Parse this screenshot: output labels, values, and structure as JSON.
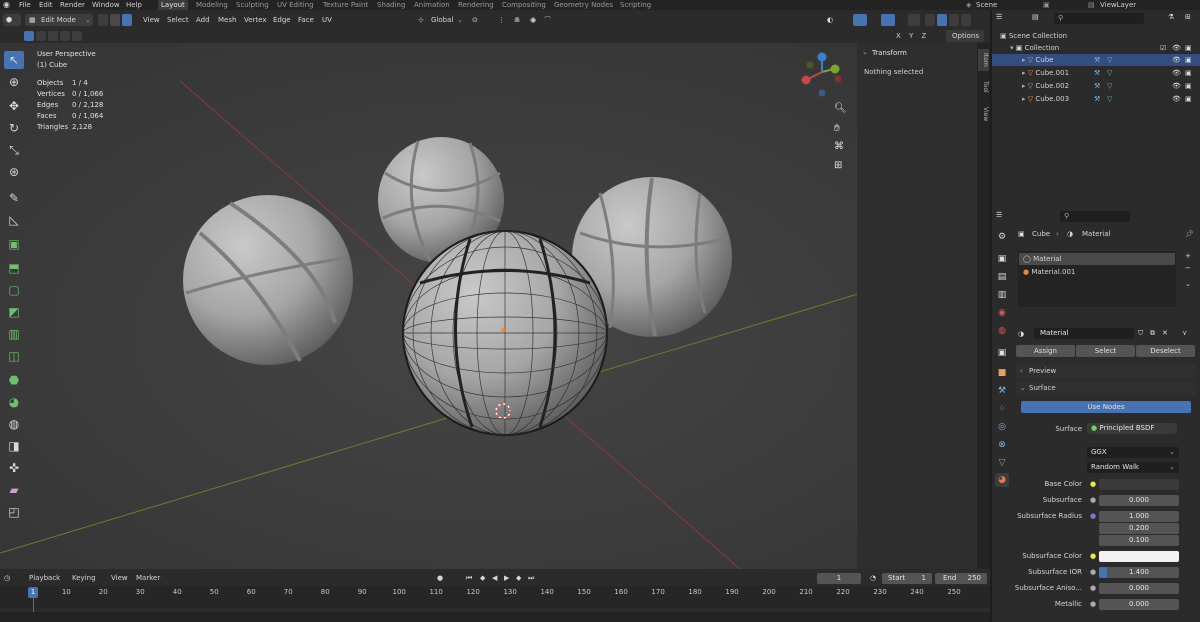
{
  "menu": [
    "File",
    "Edit",
    "Render",
    "Window",
    "Help"
  ],
  "workspaces": [
    "Layout",
    "Modeling",
    "Sculpting",
    "UV Editing",
    "Texture Paint",
    "Shading",
    "Animation",
    "Rendering",
    "Compositing",
    "Geometry Nodes",
    "Scripting"
  ],
  "scene": "Scene",
  "view_layer": "ViewLayer",
  "header": {
    "mode": "Edit Mode",
    "menus": [
      "View",
      "Select",
      "Add",
      "Mesh",
      "Vertex",
      "Edge",
      "Face",
      "UV"
    ],
    "orientation": "Global",
    "axes": "X Y Z",
    "options": "Options"
  },
  "viewport": {
    "title": "User Perspective",
    "object": "(1) Cube",
    "stats": [
      {
        "label": "Objects",
        "value": "1 / 4"
      },
      {
        "label": "Vertices",
        "value": "0 / 1,066"
      },
      {
        "label": "Edges",
        "value": "0 / 2,128"
      },
      {
        "label": "Faces",
        "value": "0 / 1,064"
      },
      {
        "label": "Triangles",
        "value": "2,128"
      }
    ]
  },
  "npanel": {
    "title": "Transform",
    "message": "Nothing selected",
    "tabs": [
      "Item",
      "Tool",
      "View"
    ]
  },
  "timeline": {
    "menus": [
      "Playback",
      "Keying",
      "View",
      "Marker"
    ],
    "current_frame": "1",
    "start_label": "Start",
    "start": "1",
    "end_label": "End",
    "end": "250",
    "ticks": [
      "1",
      "10",
      "20",
      "30",
      "40",
      "50",
      "60",
      "70",
      "80",
      "90",
      "100",
      "110",
      "120",
      "130",
      "140",
      "150",
      "160",
      "170",
      "180",
      "190",
      "200",
      "210",
      "220",
      "230",
      "240",
      "250"
    ]
  },
  "outliner": {
    "scene_collection": "Scene Collection",
    "collection": "Collection",
    "objects": [
      "Cube",
      "Cube.001",
      "Cube.002",
      "Cube.003"
    ]
  },
  "properties": {
    "breadcrumb_object": "Cube",
    "breadcrumb_material": "Material",
    "slots": [
      "Material",
      "Material.001"
    ],
    "material_name": "Material",
    "assign": "Assign",
    "select": "Select",
    "deselect": "Deselect",
    "preview": "Preview",
    "surface_section": "Surface",
    "use_nodes": "Use Nodes",
    "surface_label": "Surface",
    "surface_value": "Principled BSDF",
    "distribution": "GGX",
    "subsurface_method": "Random Walk",
    "rows": [
      {
        "label": "Base Color",
        "value": ""
      },
      {
        "label": "Subsurface",
        "value": "0.000"
      },
      {
        "label": "Subsurface Radius",
        "value": "1.000"
      },
      {
        "label": "",
        "value": "0.200"
      },
      {
        "label": "",
        "value": "0.100"
      },
      {
        "label": "Subsurface Color",
        "value": ""
      },
      {
        "label": "Subsurface IOR",
        "value": "1.400"
      },
      {
        "label": "Subsurface Aniso...",
        "value": "0.000"
      },
      {
        "label": "Metallic",
        "value": "0.000"
      }
    ]
  },
  "colors": {
    "accent": "#4772b3",
    "viewport_bg": "#3d3d3d",
    "x_axis": "#a23a3a",
    "y_axis": "#6e8a2c"
  }
}
